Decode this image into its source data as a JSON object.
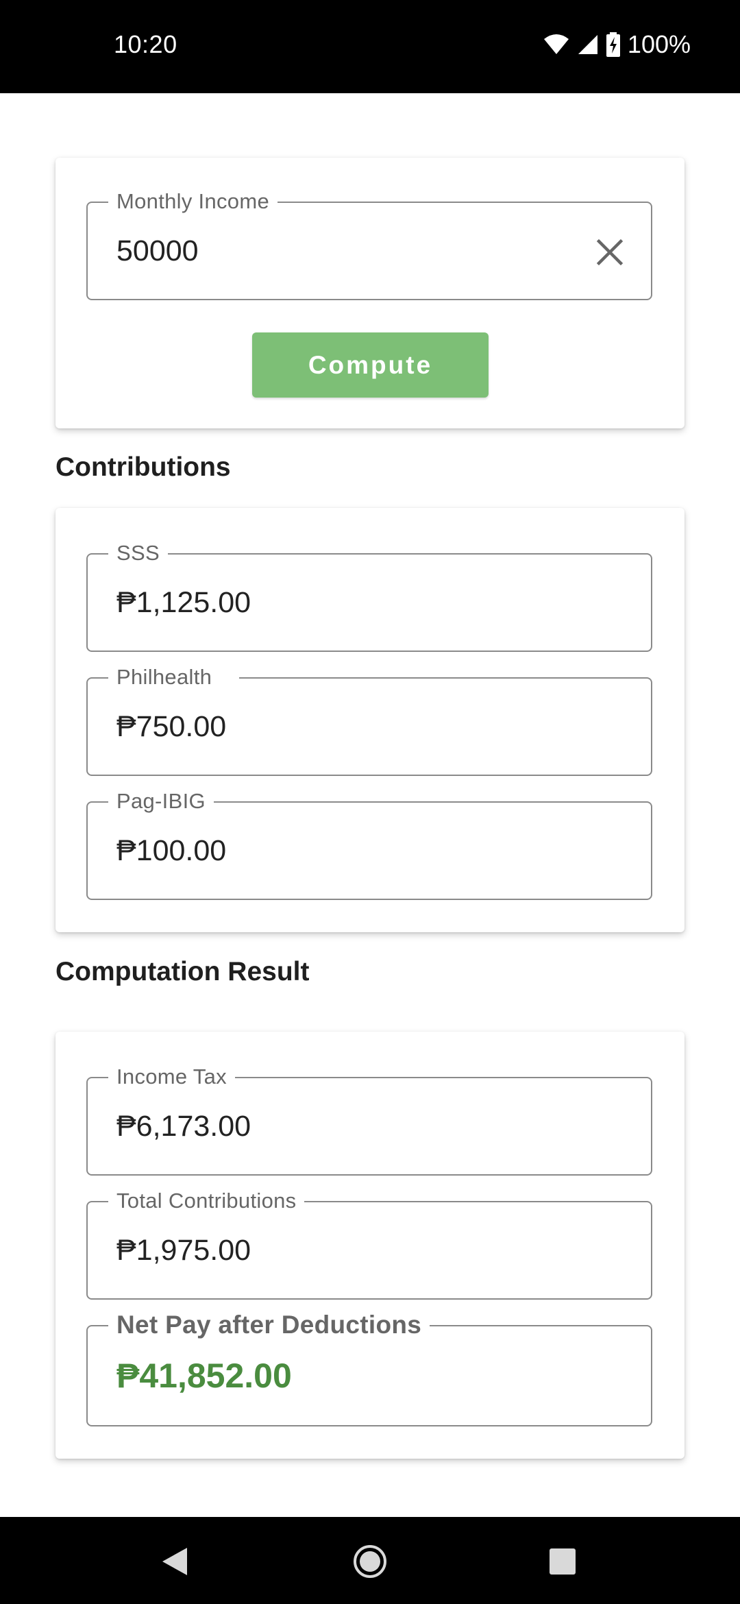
{
  "status_bar": {
    "time": "10:20",
    "battery": "100%",
    "icons": [
      "wifi-icon",
      "signal-icon",
      "battery-charging-icon"
    ]
  },
  "income_card": {
    "label": "Monthly Income",
    "value": "50000",
    "clear_icon": "close-icon",
    "compute_label": "Compute"
  },
  "contributions": {
    "heading": "Contributions",
    "sss": {
      "label": "SSS",
      "value": "₱1,125.00"
    },
    "philhealth": {
      "label": "Philhealth",
      "value": "₱750.00"
    },
    "pagibig": {
      "label": "Pag-IBIG",
      "value": "₱100.00"
    }
  },
  "result": {
    "heading": "Computation Result",
    "income_tax": {
      "label": "Income Tax",
      "value": "₱6,173.00"
    },
    "total_contributions": {
      "label": "Total Contributions",
      "value": "₱1,975.00"
    },
    "net_pay": {
      "label": "Net Pay after Deductions",
      "value": "₱41,852.00"
    }
  },
  "colors": {
    "accent_green": "#7dbf76",
    "net_pay_green": "#4a8c3f"
  },
  "nav_bar": {
    "icons": [
      "back-icon",
      "home-icon",
      "recents-icon"
    ]
  }
}
